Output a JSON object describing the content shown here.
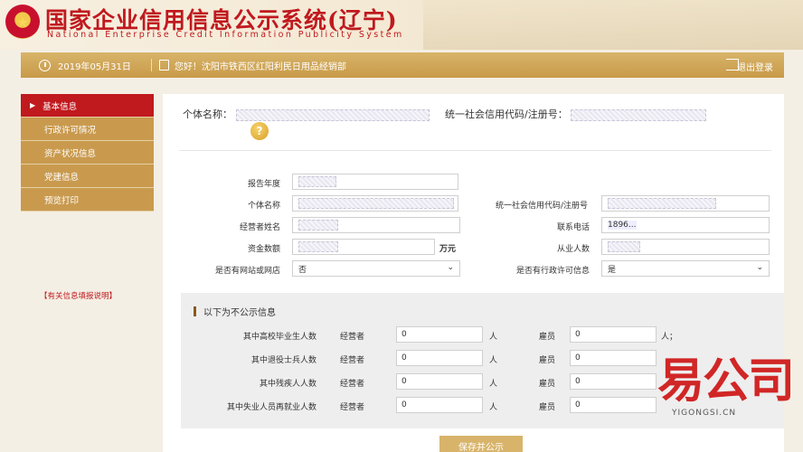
{
  "header": {
    "title": "国家企业信用信息公示系统(辽宁)",
    "subtitle": "National  Enterprise  Credit  Information  Publicity  System"
  },
  "topbar": {
    "date": "2019年05月31日",
    "greeting": "您好！沈阳市铁西区红阳利民日用品经销部",
    "logout": "退出登录"
  },
  "sidebar": {
    "items": [
      {
        "label": "基本信息"
      },
      {
        "label": "行政许可情况"
      },
      {
        "label": "资产状况信息"
      },
      {
        "label": "党建信息"
      },
      {
        "label": "预览打印"
      }
    ],
    "note": "【有关信息填报说明】"
  },
  "main": {
    "name_label": "个体名称：",
    "code_label": "统一社会信用代码/注册号：",
    "form": {
      "report_year_label": "报告年度",
      "name_label": "个体名称",
      "code_label": "统一社会信用代码/注册号",
      "operator_label": "经营者姓名",
      "phone_label": "联系电话",
      "phone_value": "1896...",
      "capital_label": "资金数额",
      "capital_unit": "万元",
      "employees_label": "从业人数",
      "website_label": "是否有网站或网店",
      "website_value": "否",
      "license_label": "是否有行政许可信息",
      "license_value": "是"
    },
    "private": {
      "title": "以下为不公示信息",
      "operator_label": "经营者",
      "employee_label": "雇员",
      "unit": "人",
      "unit_last": "人；",
      "rows": [
        {
          "label": "其中高校毕业生人数",
          "operator": "0",
          "employee": "0"
        },
        {
          "label": "其中退役士兵人数",
          "operator": "0",
          "employee": "0"
        },
        {
          "label": "其中残疾人人数",
          "operator": "0",
          "employee": "0"
        },
        {
          "label": "其中失业人员再就业人数",
          "operator": "0",
          "employee": "0"
        }
      ]
    },
    "save_label": "保存并公示"
  },
  "watermark": {
    "text": "易公司",
    "url": "YIGONGSI.CN"
  }
}
